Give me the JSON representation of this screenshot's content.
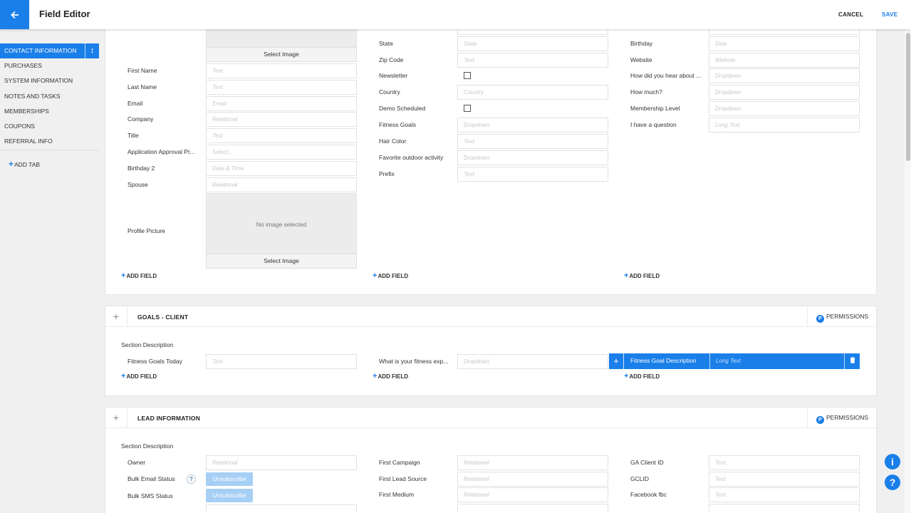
{
  "header": {
    "title": "Field Editor",
    "cancel": "CANCEL",
    "save": "SAVE"
  },
  "sidebar": {
    "items": [
      "CONTACT INFORMATION",
      "PURCHASES",
      "SYSTEM INFORMATION",
      "NOTES AND TASKS",
      "MEMBERSHIPS",
      "COUPONS",
      "REFERRAL INFO"
    ],
    "add_tab": "ADD TAB"
  },
  "common": {
    "add_field": "ADD FIELD",
    "select_image": "Select Image",
    "no_image": "No image selected",
    "section_description": "Section Description",
    "permissions": "PERMISSIONS",
    "p_letter": "P"
  },
  "contact": {
    "col1": [
      {
        "label": "First Name",
        "ph": "Text"
      },
      {
        "label": "Last Name",
        "ph": "Text"
      },
      {
        "label": "Email",
        "ph": "Email"
      },
      {
        "label": "Company",
        "ph": "Relational"
      },
      {
        "label": "Title",
        "ph": "Text"
      },
      {
        "label": "Application Approval Pr...",
        "ph": "Select..."
      },
      {
        "label": "Birthday 2",
        "ph": "Date & Time"
      },
      {
        "label": "Spouse",
        "ph": "Relational"
      }
    ],
    "profile_picture": "Profile Picture",
    "col2": [
      {
        "label": "State",
        "ph": "State"
      },
      {
        "label": "Zip Code",
        "ph": "Text"
      },
      {
        "label": "Newsletter",
        "ph": ""
      },
      {
        "label": "Country",
        "ph": "Country"
      },
      {
        "label": "Demo Scheduled",
        "ph": ""
      },
      {
        "label": "Fitness Goals",
        "ph": "Dropdown"
      },
      {
        "label": "Hair Color",
        "ph": "Text"
      },
      {
        "label": "Favorite outdoor activity",
        "ph": "Dropdown"
      },
      {
        "label": "Prefix",
        "ph": "Text"
      }
    ],
    "col3": [
      {
        "label": "Birthday",
        "ph": "Date"
      },
      {
        "label": "Website",
        "ph": "Website"
      },
      {
        "label": "How did you hear about ...",
        "ph": "Dropdown"
      },
      {
        "label": "How much?",
        "ph": "Dropdown"
      },
      {
        "label": "Membership Level",
        "ph": "Dropdown"
      },
      {
        "label": "I have a question",
        "ph": "Long Text"
      }
    ]
  },
  "goals": {
    "title": "GOALS - CLIENT",
    "f1": {
      "label": "Fitness Goals Today",
      "ph": "Text"
    },
    "f2": {
      "label": "What is your fitness exp...",
      "ph": "Dropdown"
    },
    "f3": {
      "label": "Fitness Goal Description",
      "ph": "Long Text"
    }
  },
  "lead": {
    "title": "LEAD INFORMATION",
    "col1": [
      {
        "label": "Owner",
        "ph": "Relational"
      },
      {
        "label": "Bulk Email Status",
        "btn": "Unsubscribe"
      },
      {
        "label": "Bulk SMS Status",
        "btn": "Unsubscribe"
      }
    ],
    "help": "?",
    "col2": [
      {
        "label": "First Campaign",
        "ph": "Relational"
      },
      {
        "label": "First Lead Source",
        "ph": "Relational"
      },
      {
        "label": "First Medium",
        "ph": "Relational"
      }
    ],
    "col3": [
      {
        "label": "GA Client ID",
        "ph": "Text"
      },
      {
        "label": "GCLID",
        "ph": "Text"
      },
      {
        "label": "Facebook fbc",
        "ph": "Text"
      }
    ]
  },
  "fabs": {
    "info": "i",
    "help": "?"
  }
}
